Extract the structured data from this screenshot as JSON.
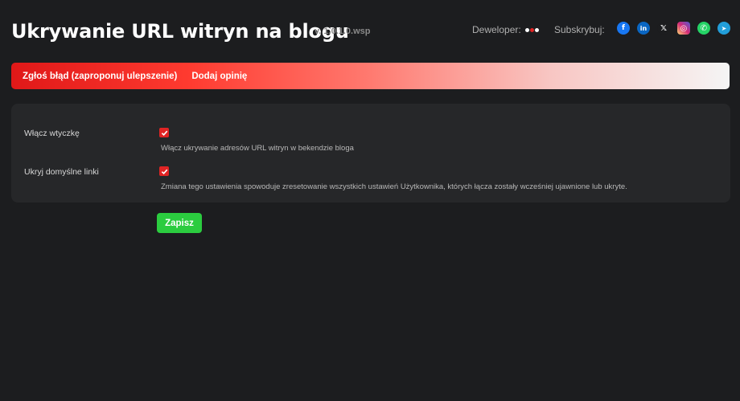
{
  "header": {
    "title": "Ukrywanie URL witryn na blogu",
    "version": "v. 1.0.1.0.wsp",
    "developer_label": "Deweloper:",
    "subscribe_label": "Subskrybuj:",
    "socials": [
      {
        "name": "facebook",
        "glyph": "f",
        "color": "#1877f2"
      },
      {
        "name": "linkedin",
        "glyph": "in",
        "color": "#0a66c2"
      },
      {
        "name": "x",
        "glyph": "𝕏",
        "color": "#1c1d1f"
      },
      {
        "name": "instagram",
        "glyph": "◎",
        "color": "#d62976"
      },
      {
        "name": "whatsapp",
        "glyph": "✆",
        "color": "#25d366"
      },
      {
        "name": "telegram",
        "glyph": "➤",
        "color": "#229ed9"
      }
    ]
  },
  "banner": {
    "report_bug": "Zgłoś błąd (zaproponuj ulepszenie)",
    "add_review": "Dodaj opinię"
  },
  "settings": [
    {
      "label": "Włącz wtyczkę",
      "checked": true,
      "description": "Włącz ukrywanie adresów URL witryn w bekendzie bloga"
    },
    {
      "label": "Ukryj domyślne linki",
      "checked": true,
      "description": "Zmiana tego ustawienia spowoduje zresetowanie wszystkich ustawień Użytkownika, których łącza zostały wcześniej ujawnione lub ukryte."
    }
  ],
  "save_button": "Zapisz",
  "colors": {
    "accent_red": "#e02424",
    "save_green": "#2bcc3f",
    "background": "#1c1d1f",
    "panel": "#262729"
  }
}
